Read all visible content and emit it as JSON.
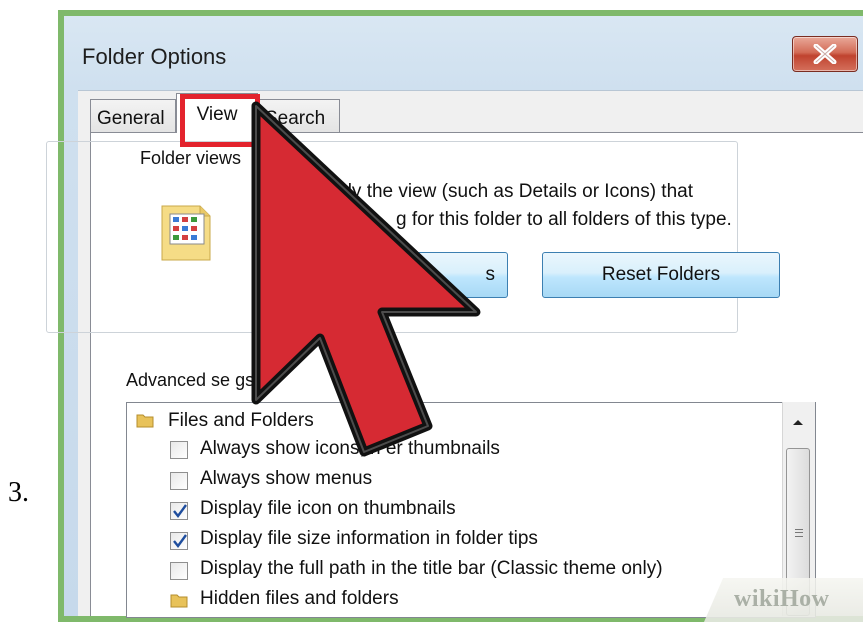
{
  "step": {
    "number": "3."
  },
  "window": {
    "title": "Folder Options"
  },
  "tabs": [
    {
      "label": "General"
    },
    {
      "label": "View"
    },
    {
      "label": "Search"
    }
  ],
  "folder_views": {
    "group_label": "Folder views",
    "description_line1": "apply the view (such as Details or Icons) that",
    "description_line2": "g for this folder to all folders of this type.",
    "apply_button_label": "s",
    "reset_button_label": "Reset Folders"
  },
  "advanced": {
    "label": "Advanced se   gs:",
    "items": [
      {
        "type": "folder",
        "label": "Files and Folders"
      },
      {
        "type": "checkbox",
        "checked": false,
        "label": "Always show icons, n   er thumbnails"
      },
      {
        "type": "checkbox",
        "checked": false,
        "label": "Always show menus"
      },
      {
        "type": "checkbox",
        "checked": true,
        "label": "Display file icon on thumbnails"
      },
      {
        "type": "checkbox",
        "checked": true,
        "label": "Display file size information in folder tips"
      },
      {
        "type": "checkbox",
        "checked": false,
        "label": "Display the full path in the title bar (Classic theme only)"
      },
      {
        "type": "folder",
        "label": "Hidden files and folders"
      }
    ]
  },
  "watermark": {
    "text": "wikiHow"
  },
  "colors": {
    "highlight_red": "#e3232d",
    "cursor_red": "#d62a33",
    "frame_green": "#7fb96b",
    "checkmark_blue": "#1f4e9e"
  },
  "icons": {
    "close": "close-x-icon",
    "folder_view": "folder-view-icon",
    "tree_folder": "folder-icon",
    "scroll_up": "chevron-up-icon",
    "cursor": "arrow-cursor-icon"
  }
}
